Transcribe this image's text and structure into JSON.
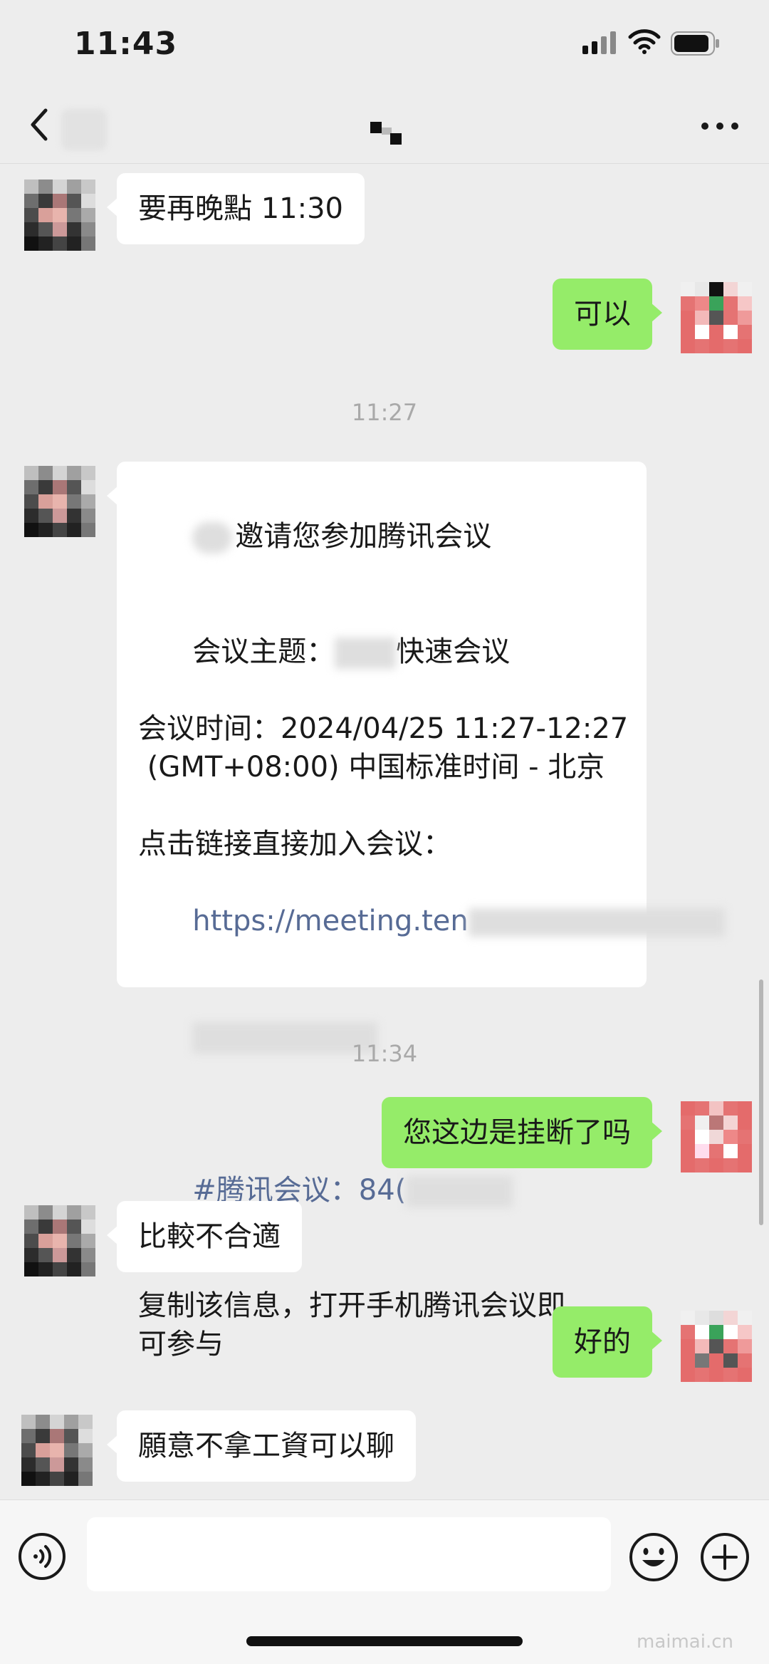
{
  "status_bar": {
    "time": "11:43"
  },
  "nav": {
    "back_icon": "chevron-left-icon",
    "more_icon": "ellipsis-icon"
  },
  "messages": [
    {
      "side": "in",
      "text": "要再晚點 11:30"
    },
    {
      "side": "out",
      "text": "可以"
    },
    {
      "type": "time",
      "text": "11:27"
    },
    {
      "side": "in",
      "type": "meeting-invite",
      "line1": "邀请您参加腾讯会议",
      "line2_label": "会议主题：",
      "line2_value": "快速会议",
      "line3": "会议时间：2024/04/25 11:27-12:27",
      "line4": " (GMT+08:00) 中国标准时间 - 北京",
      "line5": "点击链接直接加入会议：",
      "link": "https://meeting.ten",
      "tag": "#腾讯会议：84(",
      "footer_line1": "复制该信息，打开手机腾讯会议即",
      "footer_line2": "可参与"
    },
    {
      "type": "time",
      "text": "11:34"
    },
    {
      "side": "out",
      "text": "您这边是挂断了吗"
    },
    {
      "side": "in",
      "text": "比較不合適"
    },
    {
      "side": "out",
      "text": "好的"
    },
    {
      "side": "in",
      "text": "願意不拿工資可以聊"
    }
  ],
  "input_bar": {
    "placeholder": "",
    "voice_icon": "voice-icon",
    "emoji_icon": "emoji-icon",
    "plus_icon": "plus-icon"
  },
  "watermark": "maimai.cn",
  "colors": {
    "background": "#ededed",
    "outgoing": "#95ec69",
    "incoming": "#ffffff",
    "link": "#576b95"
  }
}
